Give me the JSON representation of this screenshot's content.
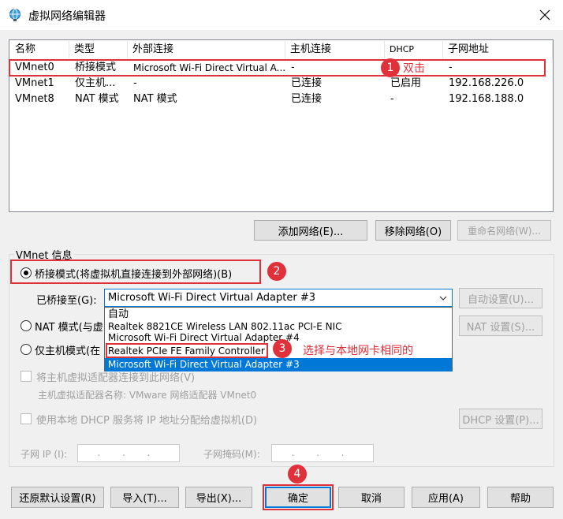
{
  "window": {
    "title": "虚拟网络编辑器",
    "icon": "globe-network-icon",
    "close_icon": "close-icon"
  },
  "table": {
    "headers": [
      "名称",
      "类型",
      "外部连接",
      "主机连接",
      "DHCP",
      "子网地址"
    ],
    "rows": [
      {
        "name": "VMnet0",
        "type": "桥接模式",
        "external": "Microsoft Wi-Fi Direct Virtual A...",
        "host": "-",
        "dhcp": "",
        "subnet": "-"
      },
      {
        "name": "VMnet1",
        "type": "仅主机...",
        "external": "-",
        "host": "已连接",
        "dhcp": "已启用",
        "subnet": "192.168.226.0"
      },
      {
        "name": "VMnet8",
        "type": "NAT 模式",
        "external": "NAT 模式",
        "host": "已连接",
        "dhcp": "-",
        "subnet": "192.168.188.0"
      }
    ]
  },
  "net_buttons": {
    "add": "添加网络(E)...",
    "remove": "移除网络(O)",
    "rename": "重命名网络(W)..."
  },
  "vmnet_info": {
    "group_title": "VMnet 信息",
    "bridged_label": "桥接模式(将虚拟机直接连接到外部网络)(B)",
    "bridged_to_label": "已桥接至(G):",
    "bridged_to_value": "Microsoft Wi-Fi Direct Virtual Adapter #3",
    "auto_settings": "自动设置(U)...",
    "nat_label": "NAT 模式(与虚",
    "nat_settings": "NAT 设置(S)...",
    "hostonly_label": "仅主机模式(在",
    "connect_host_adapter": "将主机虚拟适配器连接到此网络(V)",
    "host_adapter_name": "主机虚拟适配器名称: VMware 网络适配器 VMnet0",
    "use_dhcp": "使用本地 DHCP 服务将 IP 地址分配给虚拟机(D)",
    "dhcp_settings": "DHCP 设置(P)...",
    "subnet_ip_label": "子网 IP (I):",
    "subnet_mask_label": "子网掩码(M):",
    "ip_dots": ". . .",
    "mask_dots": ". . ."
  },
  "dropdown_options": [
    "自动",
    "Realtek 8821CE Wireless LAN 802.11ac PCI-E NIC",
    "Microsoft Wi-Fi Direct Virtual Adapter #4",
    "Realtek PCIe FE Family Controller",
    "Microsoft Wi-Fi Direct Virtual Adapter #3"
  ],
  "bottom_buttons": {
    "restore": "还原默认设置(R)",
    "import": "导入(T)...",
    "export": "导出(X)...",
    "ok": "确定",
    "cancel": "取消",
    "apply": "应用(A)",
    "help": "帮助"
  },
  "annotations": {
    "step1": "1",
    "step1_text": "双击",
    "step2": "2",
    "step3": "3",
    "step3_text": "选择与本地网卡相同的",
    "step4": "4",
    "color": "#e0303a"
  }
}
